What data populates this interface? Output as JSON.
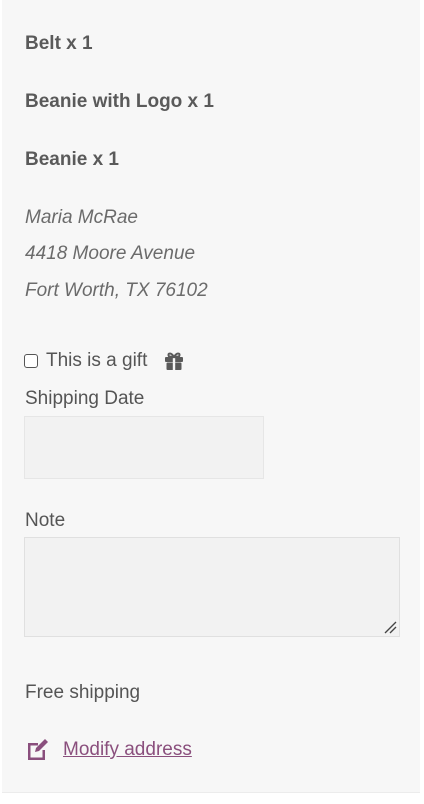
{
  "order": {
    "items": [
      "Belt x 1",
      "Beanie with Logo x 1",
      "Beanie x 1"
    ]
  },
  "address": {
    "name": "Maria McRae",
    "street": "4418 Moore Avenue",
    "city_line": "Fort Worth, TX 76102"
  },
  "gift": {
    "checkbox_label": "This is a gift",
    "checked": false,
    "icon": "gift-icon"
  },
  "form": {
    "shipping_date_label": "Shipping Date",
    "shipping_date_value": "",
    "note_label": "Note",
    "note_value": ""
  },
  "shipping": {
    "method": "Free shipping"
  },
  "actions": {
    "modify_address_label": "Modify address",
    "modify_icon": "edit-icon"
  },
  "colors": {
    "link": "#8a4f7d",
    "panel_bg": "#f7f7f7",
    "input_bg": "#f2f2f2"
  }
}
